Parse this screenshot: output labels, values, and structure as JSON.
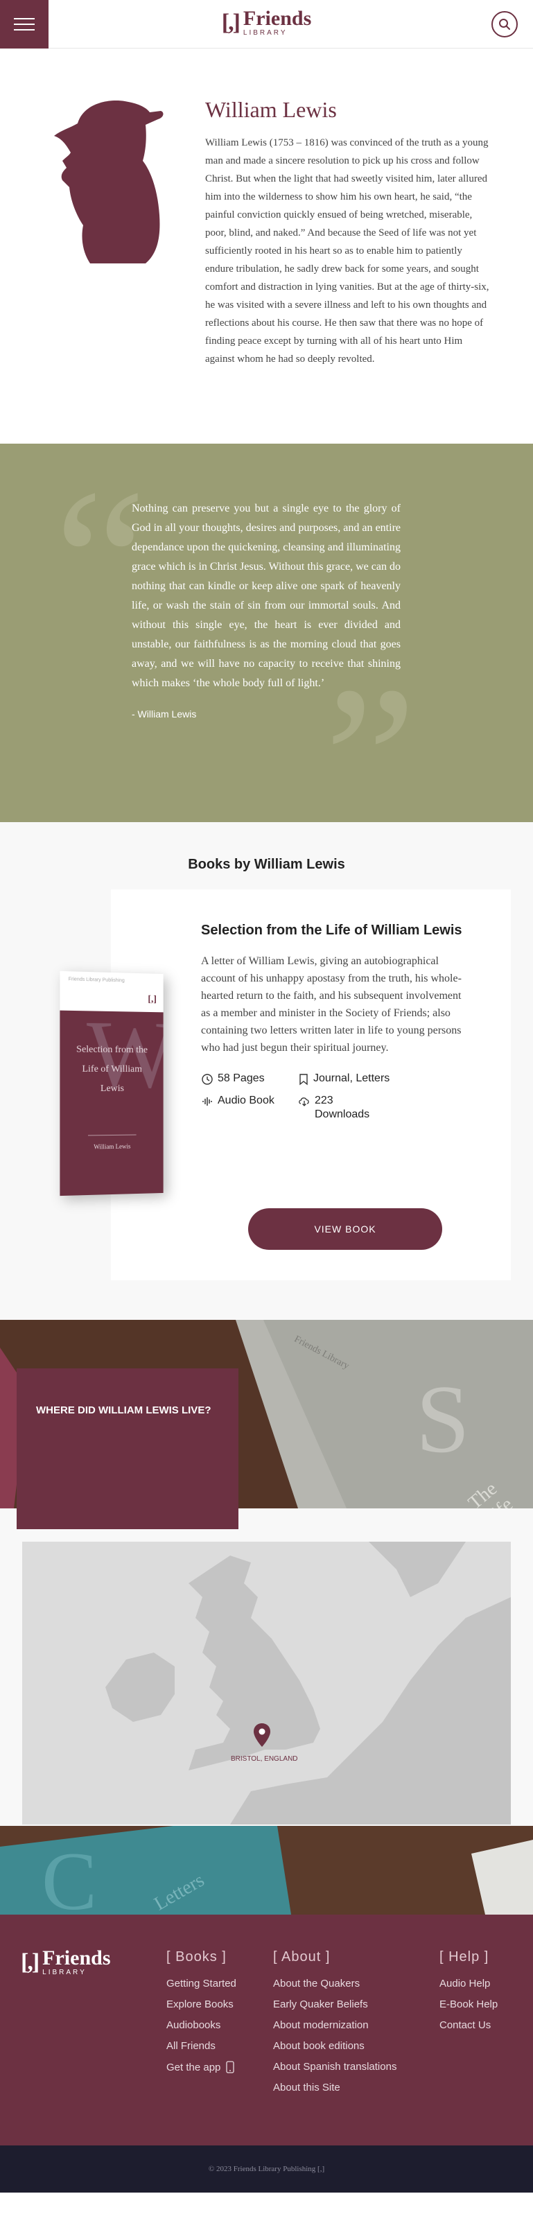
{
  "header": {
    "logo_mark": "[,]",
    "logo_word": "Friends",
    "logo_sub": "LIBRARY"
  },
  "bio": {
    "name": "William Lewis",
    "text": "William Lewis (1753 – 1816) was convinced of the truth as a young man and made a sincere resolution to pick up his cross and follow Christ. But when the light that had sweetly visited him, later allured him into the wilderness to show him his own heart, he said, “the painful conviction quickly ensued of being wretched, miserable, poor, blind, and naked.” And because the Seed of life was not yet sufficiently rooted in his heart so as to enable him to patiently endure tribulation, he sadly drew back for some years, and sought comfort and distraction in lying vanities. But at the age of thirty-six, he was visited with a severe illness and left to his own thoughts and reflections about his course. He then saw that there was no hope of finding peace except by turning with all of his heart unto Him against whom he had so deeply revolted."
  },
  "quote": {
    "text": "Nothing can preserve you but a single eye to the glory of God in all your thoughts, desires and purposes, and an entire dependance upon the quickening, cleansing and illuminating grace which is in Christ Jesus. Without this grace, we can do nothing that can kindle or keep alive one spark of heavenly life, or wash the stain of sin from our immortal souls. And without this single eye, the heart is ever divided and unstable, our faithfulness is as the morning cloud that goes away, and we will have no capacity to receive that shining which makes ‘the whole body full of light.’",
    "author": "- William Lewis"
  },
  "books": {
    "section_title": "Books by William Lewis",
    "book": {
      "title": "Selection from the Life of William Lewis",
      "description": "A letter of William Lewis, giving an autobiographical account of his unhappy apostasy from the truth, his whole-hearted return to the faith, and his subsequent involvement as a member and minister in the Society of Friends; also containing two letters written later in life to young persons who had just begun their spiritual journey.",
      "pages": "58 Pages",
      "tags": "Journal, Letters",
      "audio": "Audio Book",
      "downloads": "223 Downloads",
      "button": "VIEW BOOK",
      "cover": {
        "top_label": "Friends Library Publishing",
        "mark": "[,]",
        "letters": "WL",
        "title": "Selection from the Life of William Lewis",
        "author": "William Lewis"
      }
    }
  },
  "where": {
    "title": "WHERE DID WILLIAM LEWIS LIVE?",
    "map_label": "BRISTOL, ENGLAND",
    "photo_book_text": "Friends Library",
    "photo_book_spine": "The Life"
  },
  "footer": {
    "photo_book_text": "Letters",
    "logo_mark": "[,]",
    "logo_word": "Friends",
    "logo_sub": "LIBRARY",
    "columns": [
      {
        "head": "[ Books ]",
        "links": [
          "Getting Started",
          "Explore Books",
          "Audiobooks",
          "All Friends",
          "Get the app"
        ]
      },
      {
        "head": "[ About ]",
        "links": [
          "About the Quakers",
          "Early Quaker Beliefs",
          "About modernization",
          "About book editions",
          "About Spanish translations",
          "About this Site"
        ]
      },
      {
        "head": "[ Help ]",
        "links": [
          "Audio Help",
          "E-Book Help",
          "Contact Us"
        ]
      }
    ],
    "copyright": "© 2023 Friends Library Publishing [,]"
  },
  "colors": {
    "brand": "#6c3142",
    "olive": "#9a9d74",
    "footer_bottom": "#1d1d2e"
  },
  "icons": [
    "menu-icon",
    "search-icon",
    "clock-icon",
    "bookmark-icon",
    "audio-icon",
    "download-icon",
    "phone-icon",
    "map-pin-icon"
  ]
}
